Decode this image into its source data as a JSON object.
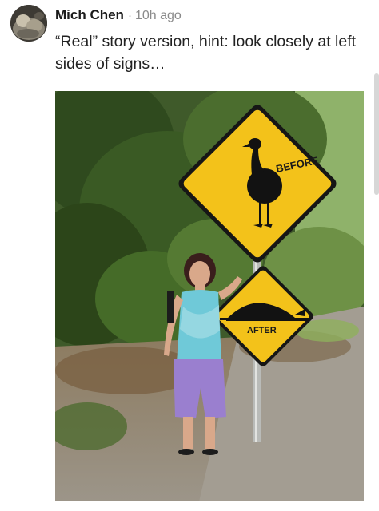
{
  "post": {
    "author": "Mich Chen",
    "separator": "·",
    "time": "10h ago",
    "text": "“Real” story version, hint: look closely at left sides of signs…"
  },
  "photo": {
    "sign_top_label": "BEFORE",
    "sign_bottom_label": "AFTER"
  },
  "icons": {
    "avatar": "avatar-icon"
  }
}
